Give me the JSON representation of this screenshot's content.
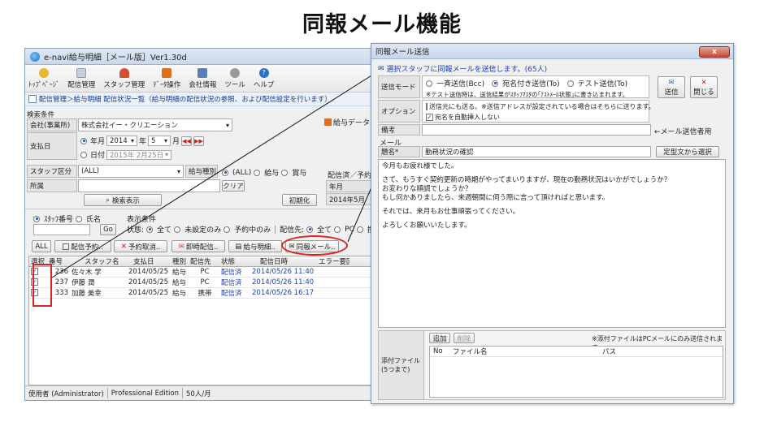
{
  "page_title": "同報メール機能",
  "main_window": {
    "title": "e-navi給与明細［メール版］Ver1.30d",
    "toolbar": [
      {
        "label": "ﾄｯﾌﾟﾍﾟｰｼﾞ",
        "icon": "home-icon",
        "color": "#e8b830"
      },
      {
        "label": "配信管理",
        "icon": "document-icon",
        "color": "#8a9bb0"
      },
      {
        "label": "スタッフ管理",
        "icon": "users-icon",
        "color": "#d05030"
      },
      {
        "label": "ﾃﾞｰﾀ操作",
        "icon": "data-icon",
        "color": "#e07020"
      },
      {
        "label": "会社情報",
        "icon": "building-icon",
        "color": "#5a7fb5"
      },
      {
        "label": "ツール",
        "icon": "tools-icon",
        "color": "#7a7a7a"
      },
      {
        "label": "ヘルプ",
        "icon": "help-icon",
        "color": "#2a6fc8"
      }
    ],
    "breadcrumb": "配信管理＞給与明細 配信状況一覧（給与明細の配信状況の参照、および配信設定を行います）",
    "search": {
      "section_label": "検索条件",
      "company_label": "会社(事業所)",
      "company_value": "株式会社イー・クリエーション",
      "delivery_date_label": "支払日",
      "month_radio": "年月",
      "year_value": "2014",
      "year_suffix": "年",
      "month_value": "5",
      "month_suffix": "月",
      "date_radio": "日付",
      "date_value": "2015年 2月25日",
      "staff_class_label": "スタッフ区分",
      "staff_class_value": "(ALL)",
      "pay_type_label": "給与種別",
      "pay_all": "(ALL)",
      "pay_salary": "給与",
      "pay_bonus": "賞与",
      "department_label": "所属",
      "clear_button": "クリア",
      "search_button": "検索表示",
      "init_button": "初期化",
      "salary_data_label": "給与データ",
      "delivered_label": "配信済／予約",
      "ym_label": "年月",
      "ym_value": "2014年5月"
    },
    "display_options": {
      "staff_no": "ｽﾀｯﾌ番号",
      "name": "氏名",
      "go_button": "Go",
      "display_cond_label": "表示条件",
      "state_label": "状態:",
      "state_all": "全て",
      "state_unset": "未設定のみ",
      "state_reserved": "予約中のみ",
      "dest_label": "配信先:",
      "dest_all": "全て",
      "dest_pc": "PC",
      "dest_mobile": "携"
    },
    "actions": {
      "all": "ALL",
      "reserve": "配信予約..",
      "cancel": "予約取消..",
      "immediate": "即時配信..",
      "pay_slip": "給与明細..",
      "broadcast": "同報メール.."
    },
    "table": {
      "headers": [
        "選択",
        "番号",
        "スタッフ名",
        "支払日",
        "種別",
        "配信先",
        "状態",
        "配信日時",
        "エラー要因"
      ],
      "rows": [
        {
          "no": "236",
          "name": "佐々木 学",
          "date": "2014/05/25",
          "type": "給与",
          "dest": "PC",
          "state": "配信済",
          "sent": "2014/05/26 11:40"
        },
        {
          "no": "237",
          "name": "伊藤 潤",
          "date": "2014/05/25",
          "type": "給与",
          "dest": "PC",
          "state": "配信済",
          "sent": "2014/05/26 11:40"
        },
        {
          "no": "333",
          "name": "加藤 美幸",
          "date": "2014/05/25",
          "type": "給与",
          "dest": "携帯",
          "state": "配信済",
          "sent": "2014/05/26 16:17"
        }
      ]
    },
    "status_bar": {
      "user": "使用者 (Administrator)",
      "edition": "Professional Edition",
      "count": "50人/月"
    }
  },
  "dialog": {
    "title": "同報メール送信",
    "close": "x",
    "info": "選択スタッフに同報メールを送信します。(65人)",
    "send_mode_label": "送信モード",
    "mode_bcc": "一斉送信(Bcc)",
    "mode_to": "宛名付き送信(To)",
    "mode_test": "テスト送信(To)",
    "mode_note": "※テスト送信時は、送信結果がｽﾀｯﾌﾏｽﾀの｢ﾃｽﾄﾒｰﾙ状態｣に書き込まれます。",
    "send_button": "送信",
    "close_button": "閉じる",
    "option_label": "オプション",
    "option_cc": "送信元にも送る。※送信アドレスが設定されている場合はそちらに送ります。",
    "option_name": "宛名を自動挿入しない",
    "memo_label": "備考",
    "memo_note": "←メール送信者用",
    "mail_label": "メール",
    "subject_label": "題名*",
    "subject_value": "勤務状況の確認",
    "template_button": "定型文から選択",
    "body_lines": [
      "今月もお疲れ様でした。",
      "",
      "さて、もうすぐ契約更新の時期がやってまいりますが、現在の勤務状況はいかがでしょうか？",
      "お変わりな順調でしょうか？",
      "もし何かありましたら、来週朝間に伺う際に言って頂ければと思います。",
      "",
      "それでは、来月もお仕事頑張ってください。",
      "",
      "よろしくお願いいたします。"
    ],
    "attach": {
      "add_button": "追加",
      "remove_button": "削除",
      "note": "※添付ファイルはPCメールにのみ送信されます。",
      "label_line1": "添付ファイル",
      "label_line2": "(5つまで)",
      "col_no": "No",
      "col_file": "ファイル名",
      "col_path": "パス"
    }
  },
  "colors": {
    "highlight": "#e02020",
    "link_blue": "#1b3fb8"
  }
}
